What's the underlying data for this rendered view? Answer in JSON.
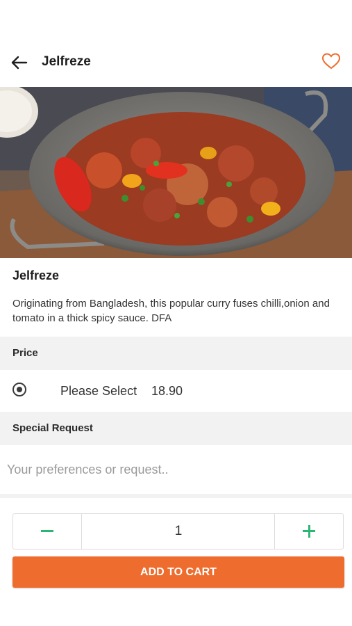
{
  "header": {
    "title": "Jelfreze",
    "back_icon": "arrow-left-icon",
    "favorite_icon": "heart-outline-icon"
  },
  "item": {
    "name": "Jelfreze",
    "description": "Originating from Bangladesh, this popular curry fuses chilli,onion and tomato in a thick spicy sauce. DFA"
  },
  "price_section": {
    "label": "Price",
    "options": [
      {
        "label": "Please Select",
        "price": "18.90",
        "selected": true
      }
    ]
  },
  "special_request": {
    "label": "Special Request",
    "value": "",
    "placeholder": "Your preferences or request.."
  },
  "quantity": {
    "value": "1"
  },
  "cart": {
    "button_label": "ADD TO CART"
  },
  "colors": {
    "accent": "#ee6c2d",
    "stepper_icon": "#2bb673",
    "section_bg": "#f2f2f2"
  }
}
